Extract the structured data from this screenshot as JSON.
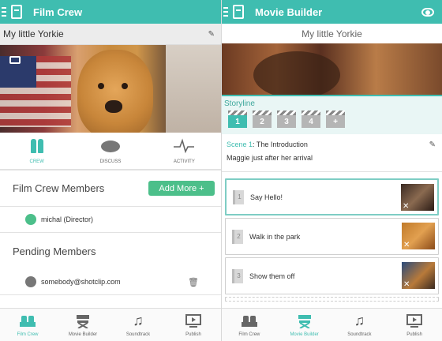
{
  "left": {
    "appbar_title": "Film Crew",
    "project_title": "My little Yorkie",
    "tabs": [
      {
        "label": "CREW",
        "icon": "crew-icon"
      },
      {
        "label": "DISCUSS",
        "icon": "discuss-icon"
      },
      {
        "label": "ACTIVITY",
        "icon": "activity-icon"
      }
    ],
    "members_heading": "Film Crew Members",
    "add_more_label": "Add More +",
    "members": [
      {
        "name": "michal (Director)",
        "color": "#4cbf8a"
      }
    ],
    "pending_heading": "Pending Members",
    "pending": [
      {
        "email": "somebody@shotclip.com",
        "color": "#777777"
      }
    ]
  },
  "right": {
    "appbar_title": "Movie Builder",
    "project_title": "My little Yorkie",
    "storyline_label": "Storyline",
    "scene_buttons": [
      "1",
      "2",
      "3",
      "4",
      "+"
    ],
    "scene_prefix": "Scene 1",
    "scene_title": ": The Introduction",
    "scene_description": "Maggie just after her arrival",
    "shots": [
      {
        "num": "1",
        "label": "Say Hello!"
      },
      {
        "num": "2",
        "label": "Walk in the park"
      },
      {
        "num": "3",
        "label": "Show them off"
      }
    ]
  },
  "bottom_nav": [
    {
      "label": "Film Crew",
      "icon": "film-crew-icon"
    },
    {
      "label": "Movie Builder",
      "icon": "director-chair-icon"
    },
    {
      "label": "Soundtrack",
      "icon": "music-note-icon"
    },
    {
      "label": "Publish",
      "icon": "publish-icon"
    }
  ],
  "colors": {
    "accent": "#3fbdb0",
    "add_button": "#4cbf8a"
  }
}
